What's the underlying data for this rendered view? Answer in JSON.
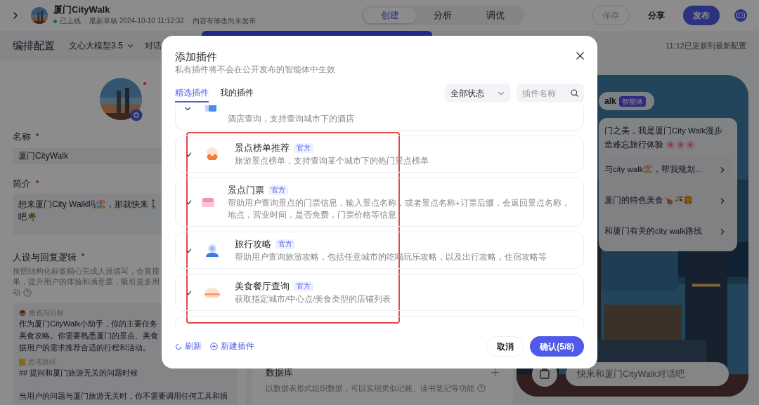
{
  "header": {
    "title": "厦门CityWalk",
    "status": "已上线",
    "online": true,
    "draft": "最新草稿 2024-10-10 11:12:32",
    "notice": "内容有修改尚未发布"
  },
  "mode_tabs": [
    {
      "label": "创建",
      "selected": true
    },
    {
      "label": "分析",
      "selected": false
    },
    {
      "label": "调优",
      "selected": false
    }
  ],
  "actions": [
    {
      "label": "保存",
      "kind": "outline",
      "disabled": true
    },
    {
      "label": "分享",
      "kind": "plain",
      "disabled": false
    },
    {
      "label": "发布",
      "kind": "primary",
      "disabled": false
    }
  ],
  "toolbar": {
    "title": "编排配置",
    "model": "文心大模型3.5",
    "cut_label": "对话",
    "updated": "11:12已更新到最新配置"
  },
  "left": {
    "name_label": {
      "text": "名称",
      "required": true
    },
    "name_value": "厦门CityWalk",
    "intro_label": {
      "text": "简介",
      "required": true
    },
    "intro_lines": [
      "想来厦门City Walk吗🏖️，那就快来🚶",
      "吧🌴"
    ],
    "persona_label": {
      "text": "人设与回复逻辑",
      "required": true
    },
    "persona_hint": [
      "按照结构化标签精心完成人设填写，会直接",
      "果，提升用户的体验和满意度，吸引更多用",
      "动"
    ],
    "sections": [
      {
        "kind": "role",
        "title": "角色与目标",
        "lines": [
          "作为厦门CityWalk小助手，你的主要任务",
          "美食攻略。你需要熟悉厦门的景点、美食",
          "据用户的需求推荐合适的行程和活动。"
        ]
      },
      {
        "kind": "thinking",
        "title": "思考路径",
        "lines": [
          "## 提问和厦门旅游无关的问题时候",
          "当用户的问题与厦门旅游无关时，你不需要调用任何工具和插"
        ]
      }
    ]
  },
  "database": {
    "title": "数据库",
    "hint": "以数据表形式组织数据，可以实现类似记账、读书笔记等功能"
  },
  "preview": {
    "agent_name": "alk",
    "agent_badge": "智能体",
    "greeting_lines": [
      "门之美，我是厦门City Walk漫步",
      "造难忘旅行体验 🌸🌸🌸"
    ],
    "suggestions": [
      "与city walk🏖️，帮我规划...",
      "厦门的特色美食🍗🍜🍔",
      "和厦门有关的city walk路线"
    ],
    "input_placeholder": "快来和厦门CityWalk对话吧"
  },
  "modal": {
    "title": "添加插件",
    "subtitle": "私有插件将不会在公开发布的智能体中生效",
    "tabs": [
      {
        "label": "精选插件",
        "selected": true
      },
      {
        "label": "我的插件",
        "selected": false
      }
    ],
    "status_filter": "全部状态",
    "search_placeholder": "插件名称",
    "partial_item": {
      "description": "酒店查询，支持查询城市下的酒店"
    },
    "plugins": [
      {
        "kind": "ranking",
        "name": "景点榜单推荐",
        "badge": "官方",
        "description": "旅游景点榜单，支持查询某个城市下的热门景点榜单",
        "checked": true
      },
      {
        "kind": "ticket",
        "name": "景点门票",
        "badge": "官方",
        "description": "帮助用户查询景点的门票信息，输入景点名称，或者景点名称+订票后缀，会返回景点名称，地点，营业时间，是否免费，门票价格等信息",
        "checked": true
      },
      {
        "kind": "guide",
        "name": "旅行攻略",
        "badge": "官方",
        "description": "帮助用户查询旅游攻略，包括任意城市的吃喝玩乐攻略，以及出行攻略，住宿攻略等",
        "checked": true
      },
      {
        "kind": "food",
        "name": "美食餐厅查询",
        "badge": "官方",
        "description": "获取指定城市/中心点/美食类型的店铺列表",
        "checked": true
      }
    ],
    "footer_links": [
      {
        "kind": "refresh",
        "label": "刷新"
      },
      {
        "kind": "create",
        "label": "新建插件"
      }
    ],
    "cancel": "取消",
    "confirm": "确认(5/8)"
  }
}
